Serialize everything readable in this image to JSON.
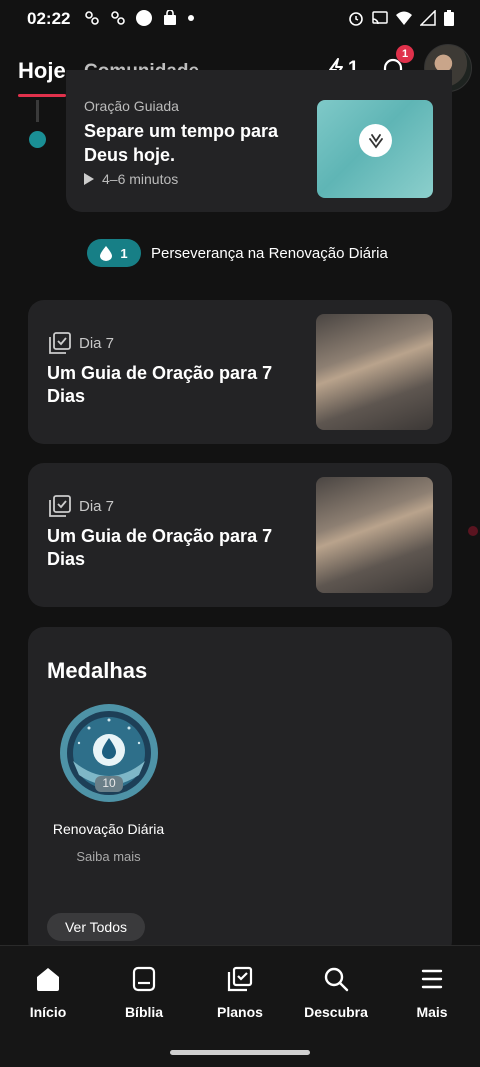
{
  "status_bar": {
    "time": "02:22",
    "left_icons": [
      "media-icon",
      "media-icon",
      "circle-icon",
      "shop-icon",
      "dot-icon"
    ],
    "right_icons": [
      "alarm-icon",
      "cast-icon",
      "wifi-icon",
      "signal-icon",
      "battery-icon"
    ]
  },
  "header": {
    "tabs": [
      {
        "label": "Hoje",
        "active": true
      },
      {
        "label": "Comunidade",
        "active": false
      }
    ],
    "streak_count": "1",
    "notification_badge": "1",
    "accent_color": "#e0314b"
  },
  "prayer_card": {
    "label": "Oração Guiada",
    "title": "Separe um tempo para Deus hoje.",
    "duration": "4–6 minutos"
  },
  "streak_banner": {
    "count": "1",
    "text": "Perseverança na Renovação Diária",
    "color": "#177f86"
  },
  "plans": [
    {
      "day": "Dia 7",
      "title": "Um Guia de Oração para 7 Dias"
    },
    {
      "day": "Dia 7",
      "title": "Um Guia de Oração para 7 Dias"
    }
  ],
  "medals": {
    "title": "Medalhas",
    "items": [
      {
        "name": "Renovação Diária",
        "link": "Saiba mais",
        "level": "10"
      }
    ],
    "view_all": "Ver Todos"
  },
  "bottom_nav": [
    {
      "label": "Início",
      "icon": "home-icon"
    },
    {
      "label": "Bíblia",
      "icon": "bible-icon"
    },
    {
      "label": "Planos",
      "icon": "plans-icon"
    },
    {
      "label": "Descubra",
      "icon": "search-icon"
    },
    {
      "label": "Mais",
      "icon": "menu-icon"
    }
  ]
}
